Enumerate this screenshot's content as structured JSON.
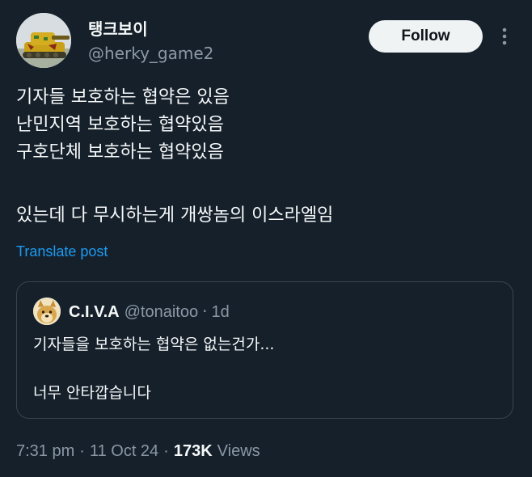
{
  "author": {
    "display_name": "탱크보이",
    "handle": "@herky_game2"
  },
  "follow_label": "Follow",
  "more_icon": "more-dots-icon",
  "tweet_lines": [
    "기자들 보호하는 협약은 있음",
    "난민지역 보호하는 협약있음",
    "구호단체 보호하는 협약있음",
    "",
    "있는데 다 무시하는게 개쌍놈의 이스라엘임"
  ],
  "translate_label": "Translate post",
  "quote": {
    "display_name": "C.I.V.A",
    "handle": "@tonaitoo",
    "separator": "·",
    "time": "1d",
    "lines": [
      "기자들을 보호하는 협약은 없는건가...",
      "",
      "너무 안타깝습니다"
    ]
  },
  "meta": {
    "time": "7:31 pm",
    "separator": "·",
    "date": "11 Oct 24",
    "views_count": "173K",
    "views_label": "Views"
  },
  "colors": {
    "background": "#15202b",
    "accent": "#1d9bf0",
    "secondary_text": "#8b98a5",
    "border": "#38444d"
  }
}
